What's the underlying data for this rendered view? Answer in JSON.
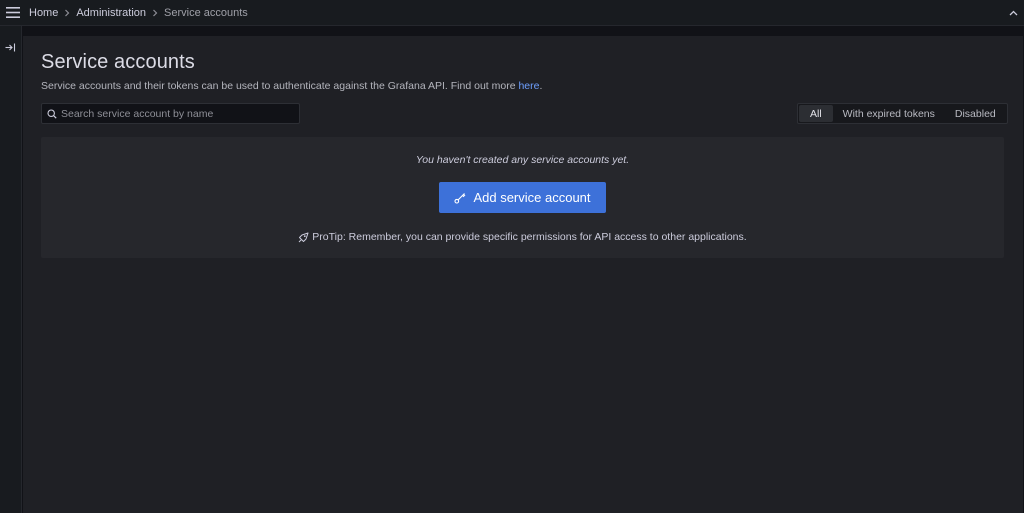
{
  "breadcrumb": {
    "items": [
      "Home",
      "Administration",
      "Service accounts"
    ]
  },
  "page": {
    "title": "Service accounts",
    "subtitle_text": "Service accounts and their tokens can be used to authenticate against the Grafana API. Find out more ",
    "subtitle_link": "here",
    "subtitle_end": "."
  },
  "search": {
    "placeholder": "Search service account by name",
    "value": ""
  },
  "filters": {
    "options": [
      "All",
      "With expired tokens",
      "Disabled"
    ],
    "selected": "All"
  },
  "empty_state": {
    "message": "You haven't created any service accounts yet.",
    "button_label": "Add service account",
    "protip": "ProTip: Remember, you can provide specific permissions for API access to other applications."
  },
  "icons": {
    "menu": "hamburger-menu-icon",
    "breadcrumb_separator": "chevron-right-icon",
    "collapse": "chevron-up-icon",
    "dock": "dock-right-icon",
    "search": "search-icon",
    "add": "key-icon",
    "protip": "rocket-icon"
  },
  "colors": {
    "primary_button": "#3d71d9",
    "link": "#6e9fff",
    "background": "#111217",
    "panel": "#1f2025",
    "card": "#26272c"
  }
}
